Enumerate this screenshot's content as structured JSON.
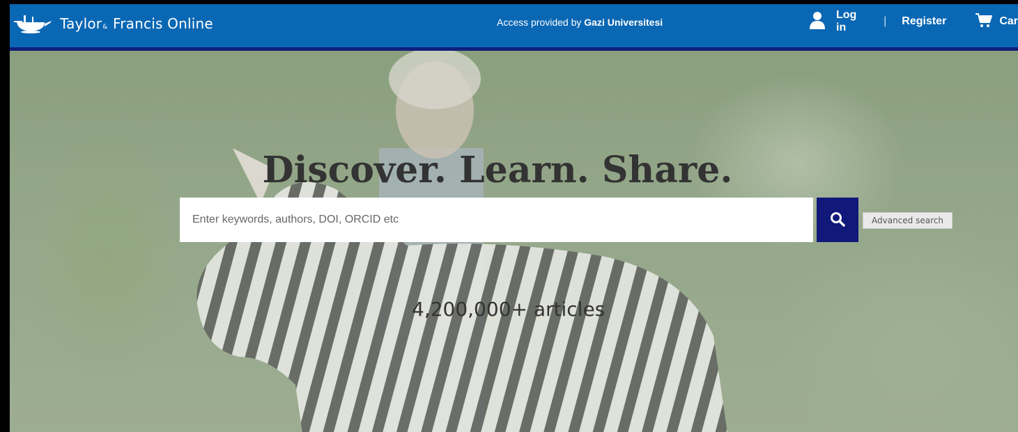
{
  "header": {
    "logo_icon": "teapot-lamp-icon",
    "brand_main": "Taylor",
    "brand_amp": "&",
    "brand_rest": "Francis Online",
    "access_prefix": "Access provided by ",
    "access_institution": "Gazi Universitesi",
    "login_label": "Log in",
    "separator": "|",
    "register_label": "Register",
    "cart_label": "Car"
  },
  "hero": {
    "headline": "Discover. Learn. Share.",
    "search_placeholder": "Enter keywords, authors, DOI, ORCID etc",
    "advanced_search_label": "Advanced search",
    "article_count": "4,200,000+ articles"
  },
  "colors": {
    "header_bg": "#0a67b4",
    "header_border": "#10207a",
    "search_button": "#10187a"
  }
}
